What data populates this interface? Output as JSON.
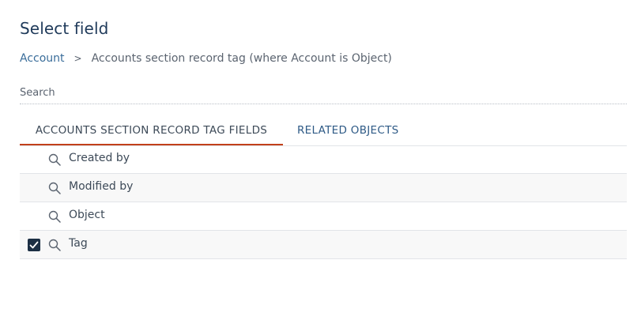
{
  "dialog": {
    "title": "Select field"
  },
  "breadcrumb": {
    "root": "Account",
    "separator": ">",
    "current": "Accounts section record tag (where Account is Object)"
  },
  "search": {
    "label": "Search"
  },
  "tabs": [
    {
      "label": "ACCOUNTS SECTION RECORD TAG FIELDS",
      "active": true
    },
    {
      "label": "RELATED OBJECTS",
      "active": false
    }
  ],
  "fields": [
    {
      "label": "Created by",
      "checked": false,
      "icon": "search-icon"
    },
    {
      "label": "Modified by",
      "checked": false,
      "icon": "search-icon"
    },
    {
      "label": "Object",
      "checked": false,
      "icon": "search-icon"
    },
    {
      "label": "Tag",
      "checked": true,
      "icon": "search-icon"
    }
  ],
  "colors": {
    "title": "#1f3a5a",
    "link": "#3a6d9a",
    "active_tab_underline": "#c2401a",
    "checkbox": "#1c2f44"
  }
}
